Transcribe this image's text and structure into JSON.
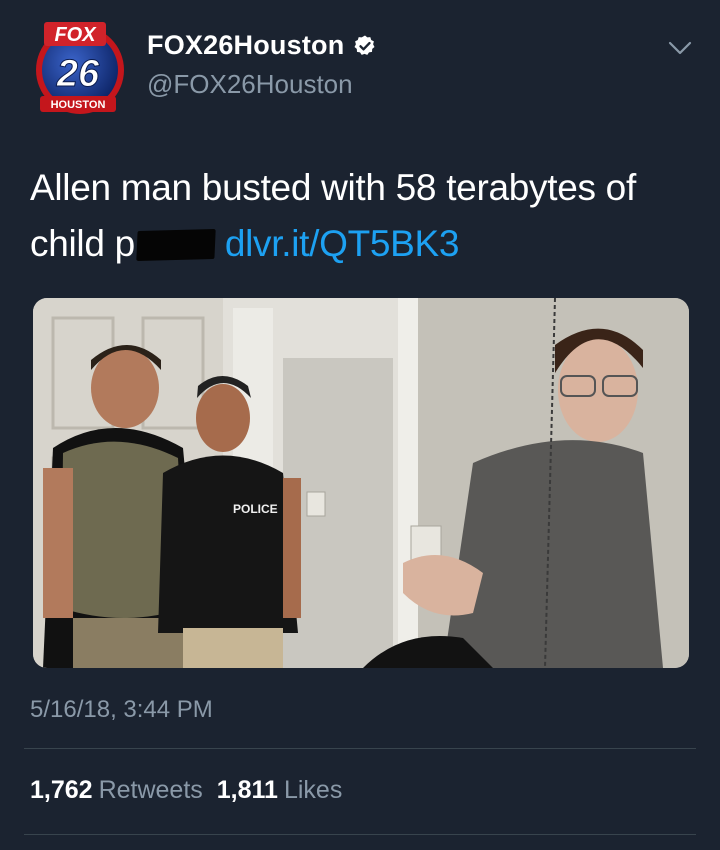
{
  "account": {
    "logo_top": "FOX",
    "logo_number": "26",
    "logo_bottom": "HOUSTON",
    "display_name": "FOX26Houston",
    "handle": "@FOX26Houston"
  },
  "tweet": {
    "text_line1": "Allen man busted with 58 terabytes of",
    "text_word": "child p",
    "link": "dlvr.it/QT5BK3",
    "photo_police_label": "POLICE",
    "timestamp": "5/16/18, 3:44 PM"
  },
  "stats": {
    "retweets_count": "1,762",
    "retweets_label": "Retweets",
    "likes_count": "1,811",
    "likes_label": "Likes"
  },
  "colors": {
    "background": "#1b2330",
    "link": "#1da1f2",
    "secondary_text": "#8a99a8",
    "divider": "#38444d",
    "logo_red": "#d1232a",
    "logo_blue": "#1c3f94"
  },
  "icons": [
    "fox26-logo",
    "verified-badge-icon",
    "chevron-down-icon"
  ]
}
